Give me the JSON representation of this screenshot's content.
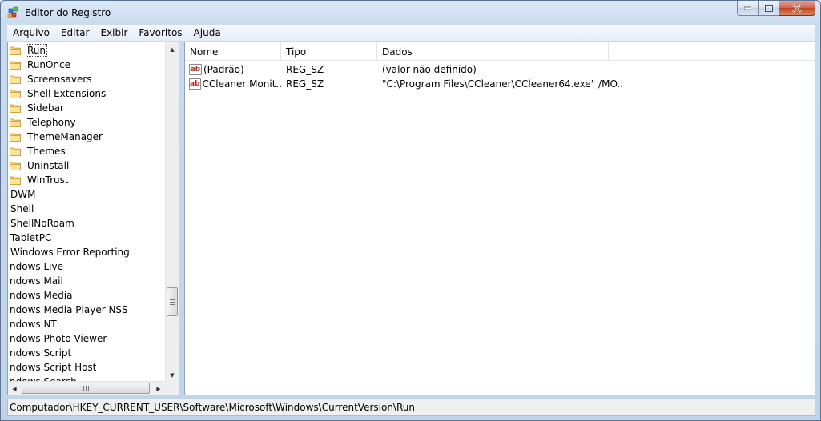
{
  "window": {
    "title": "Editor do Registro"
  },
  "menu": [
    "Arquivo",
    "Editar",
    "Exibir",
    "Favoritos",
    "Ajuda"
  ],
  "tree": {
    "folder_items": [
      "Run",
      "RunOnce",
      "Screensavers",
      "Shell Extensions",
      "Sidebar",
      "Telephony",
      "ThemeManager",
      "Themes",
      "Uninstall",
      "WinTrust"
    ],
    "selected": "Run",
    "plain_items": [
      "DWM",
      "Shell",
      "ShellNoRoam",
      "TabletPC",
      "Windows Error Reporting"
    ],
    "clipped_items": [
      "ndows Live",
      "ndows Mail",
      "ndows Media",
      "ndows Media Player NSS",
      "ndows NT",
      "ndows Photo Viewer",
      "ndows Script",
      "ndows Script Host",
      "ndows Search"
    ]
  },
  "list": {
    "columns": [
      "Nome",
      "Tipo",
      "Dados"
    ],
    "rows": [
      {
        "name": "(Padrão)",
        "type": "REG_SZ",
        "data": "(valor não definido)"
      },
      {
        "name": "CCleaner Monit...",
        "type": "REG_SZ",
        "data": "\"C:\\Program Files\\CCleaner\\CCleaner64.exe\" /MO..."
      }
    ]
  },
  "status": {
    "path": "Computador\\HKEY_CURRENT_USER\\Software\\Microsoft\\Windows\\CurrentVersion\\Run"
  }
}
